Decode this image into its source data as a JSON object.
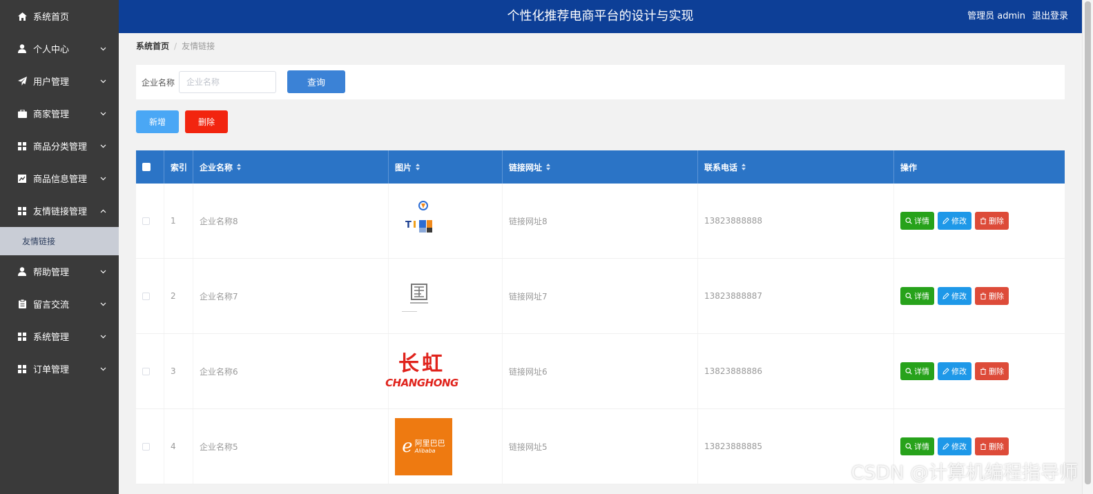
{
  "header": {
    "title": "个性化推荐电商平台的设计与实现",
    "user_label": "管理员 admin",
    "logout_label": "退出登录"
  },
  "sidebar": {
    "items": [
      {
        "label": "系统首页",
        "icon": "home-icon",
        "has_arrow": false
      },
      {
        "label": "个人中心",
        "icon": "user-icon",
        "has_arrow": true
      },
      {
        "label": "用户管理",
        "icon": "paper-plane-icon",
        "has_arrow": true
      },
      {
        "label": "商家管理",
        "icon": "briefcase-icon",
        "has_arrow": true
      },
      {
        "label": "商品分类管理",
        "icon": "grid-icon",
        "has_arrow": true
      },
      {
        "label": "商品信息管理",
        "icon": "chart-icon",
        "has_arrow": true
      },
      {
        "label": "友情链接管理",
        "icon": "grid-icon",
        "has_arrow": true,
        "expanded": true
      },
      {
        "label": "帮助管理",
        "icon": "user-icon",
        "has_arrow": true
      },
      {
        "label": "留言交流",
        "icon": "clipboard-icon",
        "has_arrow": true
      },
      {
        "label": "系统管理",
        "icon": "grid-icon",
        "has_arrow": true
      },
      {
        "label": "订单管理",
        "icon": "grid-icon",
        "has_arrow": true
      }
    ],
    "submenu": {
      "label": "友情链接"
    }
  },
  "breadcrumb": {
    "home": "系统首页",
    "separator": "/",
    "current": "友情链接"
  },
  "search": {
    "label": "企业名称",
    "placeholder": "企业名称",
    "value": "",
    "button": "查询"
  },
  "actions": {
    "add": "新增",
    "delete": "删除"
  },
  "table": {
    "columns": [
      "索引",
      "企业名称",
      "图片",
      "链接网址",
      "联系电话",
      "操作"
    ],
    "rows": [
      {
        "index": "1",
        "name": "企业名称8",
        "image": "logo-tf",
        "url": "链接网址8",
        "phone": "13823888888"
      },
      {
        "index": "2",
        "name": "企业名称7",
        "image": "logo-seal",
        "url": "链接网址7",
        "phone": "13823888887"
      },
      {
        "index": "3",
        "name": "企业名称6",
        "image": "logo-changhong",
        "url": "链接网址6",
        "phone": "13823888886"
      },
      {
        "index": "4",
        "name": "企业名称5",
        "image": "logo-alibaba",
        "url": "链接网址5",
        "phone": "13823888885"
      }
    ],
    "row_actions": {
      "detail": "详情",
      "edit": "修改",
      "delete": "删除"
    }
  },
  "logos": {
    "changhong": {
      "cn": "长虹",
      "en": "CHANGHONG"
    },
    "alibaba": {
      "cn": "阿里巴巴",
      "en": "Alibaba"
    }
  },
  "watermark": "CSDN @计算机编程指导师",
  "colors": {
    "header_bg": "#0d3f97",
    "sidebar_bg": "#3a3a3a",
    "table_head": "#2b74c6",
    "detail": "#27a21b",
    "edit": "#1e98e8",
    "delete": "#dd4b39"
  }
}
